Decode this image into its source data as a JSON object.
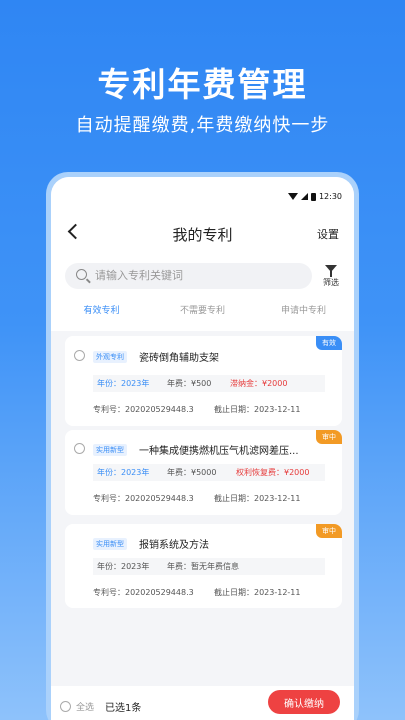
{
  "banner": {
    "title": "专利年费管理",
    "subtitle": "自动提醒缴费,年费缴纳快一步"
  },
  "status_bar": {
    "time": "12:30"
  },
  "header": {
    "title": "我的专利",
    "settings_label": "设置"
  },
  "search": {
    "placeholder": "请输入专利关键词",
    "filter_label": "筛选"
  },
  "tabs": [
    {
      "label": "有效专利",
      "active": true
    },
    {
      "label": "不需要专利",
      "active": false
    },
    {
      "label": "申请中专利",
      "active": false
    }
  ],
  "patents": [
    {
      "badge": "有效",
      "badge_color": "#3a8ef6",
      "type": "外观专利",
      "title": "瓷砖倒角辅助支架",
      "year": "年份：2023年",
      "fee": "年费：¥500",
      "extra_fee": "滞纳金：¥2000",
      "number": "专利号：202020529448.3",
      "deadline": "截止日期：2023-12-11"
    },
    {
      "badge": "审中",
      "badge_color": "#f29a25",
      "type": "实用新型",
      "title": "一种集成便携燃机压气机滤网差压...",
      "year": "年份：2023年",
      "fee": "年费：¥5000",
      "extra_fee": "权利恢复费：¥2000",
      "number": "专利号：202020529448.3",
      "deadline": "截止日期：2023-12-11"
    },
    {
      "badge": "审中",
      "badge_color": "#f29a25",
      "type": "实用新型",
      "title": "报销系统及方法",
      "year": "年份：2023年",
      "fee": "年费：暂无年费信息",
      "extra_fee": "",
      "number": "专利号：202020529448.3",
      "deadline": "截止日期：2023-12-11"
    }
  ],
  "bottom_bar": {
    "select_all_label": "全选",
    "selected_count": "已选1条",
    "confirm_label": "确认缴纳"
  },
  "colors": {
    "accent": "#3a8ef6",
    "danger": "#ee4242",
    "pending": "#f29a25"
  }
}
